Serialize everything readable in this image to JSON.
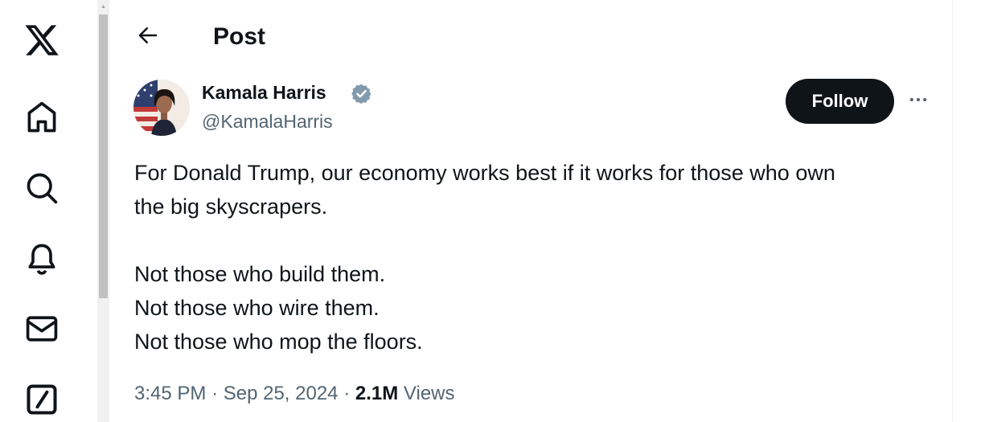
{
  "nav": {
    "items": [
      {
        "name": "x-logo-icon"
      },
      {
        "name": "home-icon"
      },
      {
        "name": "search-icon"
      },
      {
        "name": "notifications-bell-icon"
      },
      {
        "name": "messages-mail-icon"
      },
      {
        "name": "grok-icon"
      }
    ]
  },
  "header": {
    "title": "Post",
    "back_icon": "arrow-left-icon"
  },
  "tweet": {
    "author": {
      "name": "Kamala Harris",
      "handle": "@KamalaHarris",
      "verified_icon": "verified-badge-icon",
      "verified_color": "#829aab"
    },
    "follow_label": "Follow",
    "more_icon": "more-horizontal-icon",
    "text": {
      "line1": "For Donald Trump, our economy works best if it works for those who own",
      "line2": "the big skyscrapers.",
      "line3": "Not those who build them.",
      "line4": "Not those who wire them.",
      "line5": "Not those who mop the floors."
    },
    "meta": {
      "time": "3:45 PM",
      "separator": "·",
      "date": "Sep 25, 2024",
      "views_count": "2.1M",
      "views_label": "Views"
    }
  },
  "colors": {
    "text_primary": "#0f1419",
    "text_secondary": "#536471",
    "follow_bg": "#0f1419",
    "follow_text": "#ffffff"
  }
}
